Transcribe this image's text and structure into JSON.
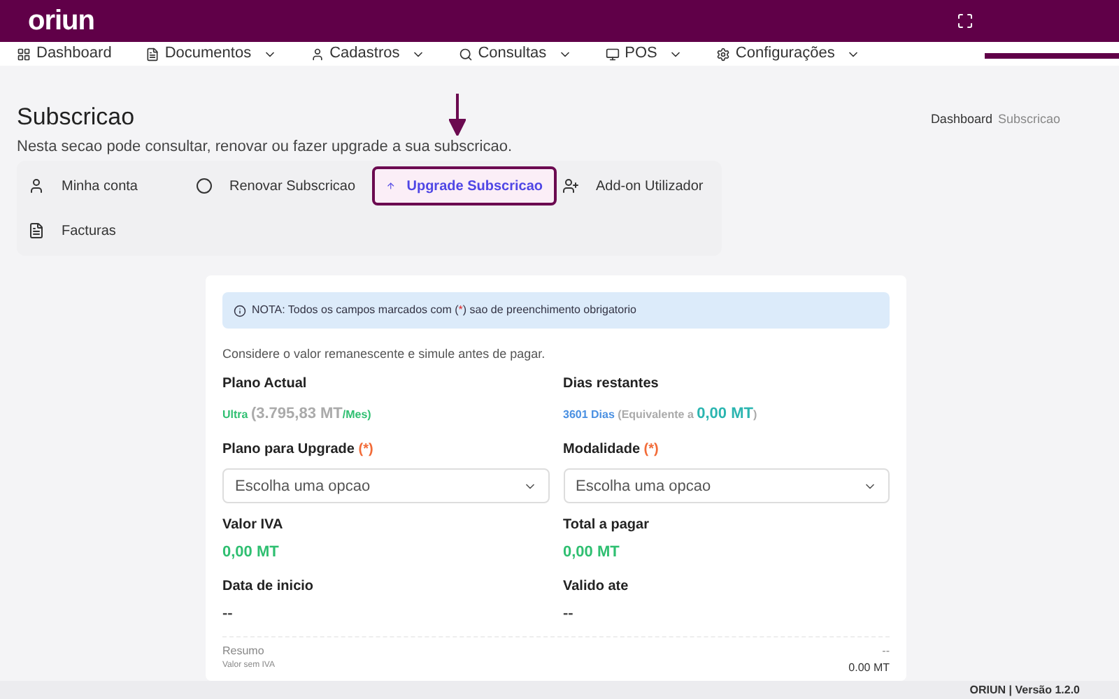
{
  "header": {
    "logo": "oriun"
  },
  "nav": [
    {
      "label": "Dashboard",
      "dropdown": false
    },
    {
      "label": "Documentos",
      "dropdown": true
    },
    {
      "label": "Cadastros",
      "dropdown": true
    },
    {
      "label": "Consultas",
      "dropdown": true
    },
    {
      "label": "POS",
      "dropdown": true
    },
    {
      "label": "Configurações",
      "dropdown": true
    }
  ],
  "page": {
    "title": "Subscricao",
    "subtitle": "Nesta secao pode consultar, renovar ou fazer upgrade a sua subscricao.",
    "breadcrumb": [
      "Dashboard",
      "Subscricao"
    ]
  },
  "tabs": [
    {
      "label": "Minha conta",
      "selected": false
    },
    {
      "label": "Renovar Subscricao",
      "selected": false
    },
    {
      "label": "Upgrade Subscricao",
      "selected": true
    },
    {
      "label": "Add-on Utilizador",
      "selected": false
    },
    {
      "label": "Facturas",
      "selected": false
    }
  ],
  "note": {
    "prefix": "NOTA: Todos os campos marcados com (",
    "mark": "*",
    "suffix": ") sao de preenchimento obrigatorio"
  },
  "hint": "Considere o valor remanescente e simule antes de pagar.",
  "current_plan": {
    "label": "Plano Actual",
    "plan": "Ultra",
    "price": "(3.795,83 MT",
    "period": "/Mes)"
  },
  "remaining": {
    "label": "Dias restantes",
    "days": "3601 Dias",
    "prefix": "(Equivalente a ",
    "amount": "0,00 MT",
    "suffix": ")"
  },
  "selects": [
    {
      "label": "Plano para Upgrade",
      "required_mark": "(*)",
      "placeholder": "Escolha uma opcao"
    },
    {
      "label": "Modalidade",
      "required_mark": "(*)",
      "placeholder": "Escolha uma opcao"
    }
  ],
  "values": [
    {
      "label": "Valor IVA",
      "value": "0,00 MT",
      "kind": "amount"
    },
    {
      "label": "Total a pagar",
      "value": "0,00 MT",
      "kind": "amount"
    },
    {
      "label": "Data de inicio",
      "value": "--",
      "kind": "plain"
    },
    {
      "label": "Valido ate",
      "value": "--",
      "kind": "plain"
    }
  ],
  "summary": {
    "title": "Resumo",
    "title_value": "--",
    "label": "Valor sem IVA",
    "value": "0.00 MT"
  },
  "footer": "ORIUN | Versão 1.2.0"
}
